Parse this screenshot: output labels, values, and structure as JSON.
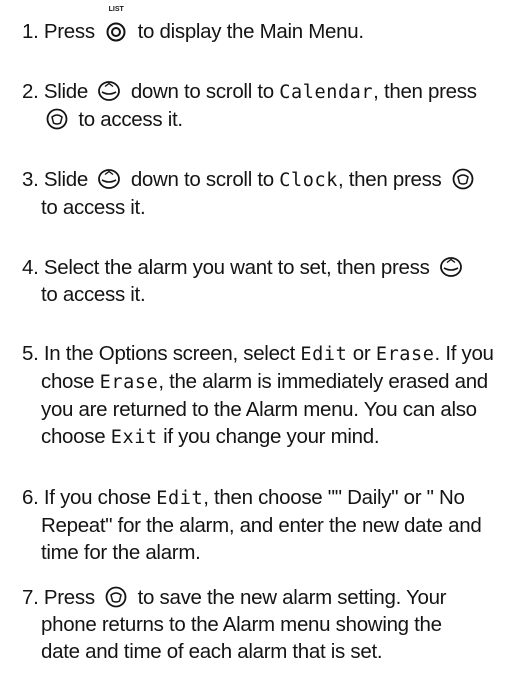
{
  "steps": [
    {
      "num": "1.",
      "a": "Press",
      "list_caption": "LIST",
      "b": "to display the Main Menu."
    },
    {
      "num": "2.",
      "a": "Slide",
      "b": "down to scroll to",
      "target": "Calendar",
      "c": ", then press",
      "d": "to access it."
    },
    {
      "num": "3.",
      "a": "Slide",
      "b": "down to scroll to",
      "target": "Clock",
      "c": ", then press",
      "d": "to access it."
    },
    {
      "num": "4.",
      "a": "Select the alarm you want to set, then press",
      "b": "to access it."
    },
    {
      "num": "5.",
      "a": "In the Options screen, select",
      "edit": "Edit",
      "or": "or",
      "erase": "Erase",
      "b": ". If you",
      "c": "chose",
      "erase2": "Erase",
      "d": ", the alarm is immediately erased and",
      "e": "you are returned to the Alarm menu. You can also",
      "f": "choose",
      "exit": "Exit",
      "g": "if you change your mind."
    },
    {
      "num": "6.",
      "a": "If you chose",
      "edit": "Edit",
      "b": ", then choose \"\" Daily\" or \" No",
      "c": "Repeat\" for the alarm, and enter the new date and",
      "d": "time for the alarm."
    },
    {
      "num": "7.",
      "a": "Press",
      "b": "to save the new alarm setting. Your",
      "c": "phone returns to the Alarm menu showing the",
      "d": "date and time of each alarm that is set."
    }
  ]
}
